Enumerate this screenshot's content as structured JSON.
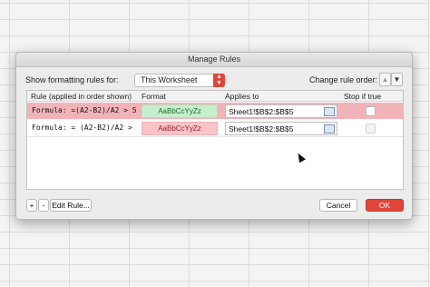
{
  "dialog": {
    "title": "Manage Rules",
    "show_rules_label": "Show formatting rules for:",
    "show_rules_value": "This Worksheet",
    "change_order_label": "Change rule order:"
  },
  "table": {
    "headers": [
      "Rule (applied in order shown)",
      "Format",
      "Applies to",
      "Stop if true"
    ],
    "rows": [
      {
        "formula": "Formula: =(A2-B2)/A2 > 5...",
        "preview": "AaBbCcYyZz",
        "range": "Sheet1!$B$2:$B$5",
        "selected": true
      },
      {
        "formula": "Formula: = (A2-B2)/A2 > 5...",
        "preview": "AaBbCcYyZz",
        "range": "Sheet1!$B$2:$B$5",
        "selected": false
      }
    ]
  },
  "footer": {
    "add_label": "+",
    "remove_label": "-",
    "edit_label": "Edit Rule...",
    "cancel_label": "Cancel",
    "ok_label": "OK"
  },
  "colors": {
    "accent": "#e0453b",
    "selected_row": "#f2b3b8"
  }
}
